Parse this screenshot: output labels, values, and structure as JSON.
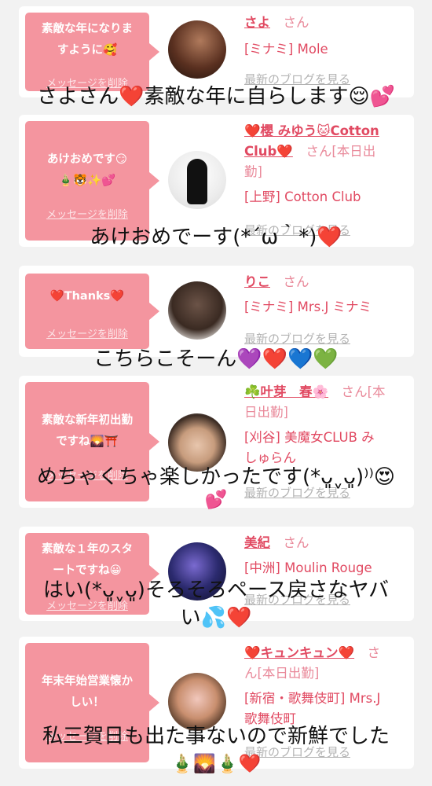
{
  "cards": [
    {
      "bubble_lines": [
        "素敵な年になりま",
        "すように🥰"
      ],
      "delete_label": "メッセージを削除",
      "name": "さよ",
      "san": "さん",
      "shop_lines": [
        "[ミナミ] Mole"
      ],
      "blog_label": "最新のブログを見る"
    },
    {
      "bubble_lines": [
        "あけおめです😏",
        "🎍🐯✨💕"
      ],
      "delete_label": "メッセージを削除",
      "name_lines": [
        "❤️櫻 みゆう🐱Cotton",
        "Club❤️"
      ],
      "san_suffix": "さん[本日出",
      "name_tail": "勤]",
      "shop_lines": [
        "[上野] Cotton Club"
      ],
      "blog_label": "最新のブログを見る"
    },
    {
      "bubble_lines": [
        "❤️Thanks❤️"
      ],
      "delete_label": "メッセージを削除",
      "name": "りこ",
      "san": "さん",
      "shop_lines": [
        "[ミナミ] Mrs.J ミナミ"
      ],
      "blog_label": "最新のブログを見る"
    },
    {
      "bubble_lines": [
        "素敵な新年初出勤",
        "ですね🌄⛩️"
      ],
      "delete_label": "メッセージを削除",
      "name": "☘️叶芽　春🌸",
      "san_suffix": "さん[本",
      "name_tail": "日出勤]",
      "shop_lines": [
        "[刈谷] 美魔女CLUB み",
        "しゅらん"
      ],
      "blog_label": "最新のブログを見る"
    },
    {
      "bubble_lines": [
        "素敵な１年のスタ",
        "ートですね😀"
      ],
      "delete_label": "メッセージを削除",
      "name": "美紀",
      "san": "さん",
      "shop_lines": [
        "[中洲] Moulin Rouge"
      ],
      "blog_label": "最新のブログを見る"
    },
    {
      "bubble_lines": [
        "年末年始営業懐か",
        "しい！"
      ],
      "delete_label": "メッセージを削除",
      "name": "❤️キュンキュン❤️",
      "san": "さ",
      "name_tail": "ん[本日出勤]",
      "shop_lines": [
        "[新宿・歌舞伎町] Mrs.J",
        "歌舞伎町"
      ],
      "blog_label": "最新のブログを見る"
    }
  ],
  "overlays": [
    {
      "text": "さよさん",
      "heart": "❤️",
      "text2": "素敵な年に自らします😌💕"
    },
    {
      "text": "あけおめでーす(*´ω｀*)",
      "heart": "❤️"
    },
    {
      "text": "こちらこそーん💜❤️💙💚"
    },
    {
      "text": "めちゃくちゃ楽しかったです(*ᴗ͈ˬᴗ͈)⁾⁾😍",
      "line2": "💕"
    },
    {
      "text": "はい(*ᴗ͈ˬᴗ͈)そろそろペース戻さなヤバ",
      "line2": "い💦",
      "heart": "❤️"
    },
    {
      "text": "私三賀日も出た事ないので新鮮でした",
      "line2": "🎍🌄🎍",
      "heart": "❤️"
    }
  ],
  "colors": {
    "background": "#f2f2f2",
    "bubble": "#f4959f",
    "name": "#e14a62",
    "link_gray": "#b3b3b3"
  }
}
